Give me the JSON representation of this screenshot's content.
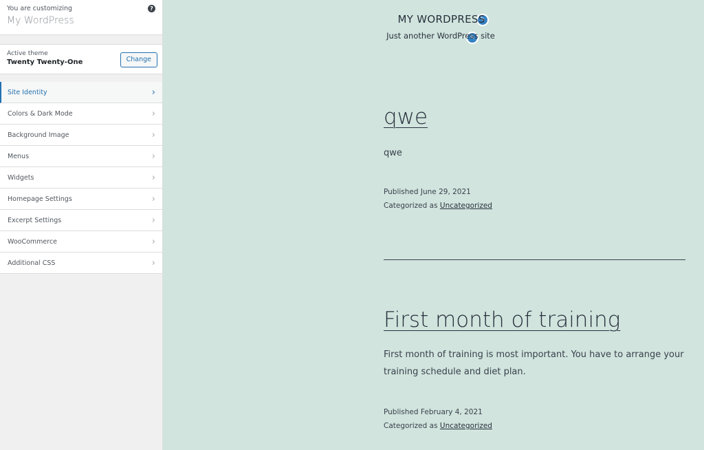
{
  "sidebar": {
    "customizing_label": "You are customizing",
    "site_name": "My WordPress",
    "help_icon": "?",
    "theme": {
      "label": "Active theme",
      "name": "Twenty Twenty-One",
      "change_label": "Change"
    },
    "items": [
      {
        "label": "Site Identity",
        "active": true
      },
      {
        "label": "Colors & Dark Mode"
      },
      {
        "label": "Background Image"
      },
      {
        "label": "Menus"
      },
      {
        "label": "Widgets"
      },
      {
        "label": "Homepage Settings"
      },
      {
        "label": "Excerpt Settings"
      },
      {
        "label": "WooCommerce"
      },
      {
        "label": "Additional CSS"
      }
    ],
    "chevron": "›"
  },
  "preview": {
    "site_title": "MY WORDPRESS",
    "site_description": "Just another WordPress site",
    "edit_icon": "✎",
    "posts": [
      {
        "title": "qwe",
        "excerpt": "qwe",
        "published": "Published June 29, 2021",
        "category_prefix": "Categorized as ",
        "category": "Uncategorized"
      },
      {
        "title": "First month of training",
        "excerpt": "First month of training is most important. You have to arrange your training schedule and diet plan.",
        "published": "Published February 4, 2021",
        "category_prefix": "Categorized as ",
        "category": "Uncategorized"
      }
    ]
  },
  "colors": {
    "accent": "#2271b1",
    "preview_bg": "#d1e4dd",
    "edit_pen": "#3582c4"
  }
}
